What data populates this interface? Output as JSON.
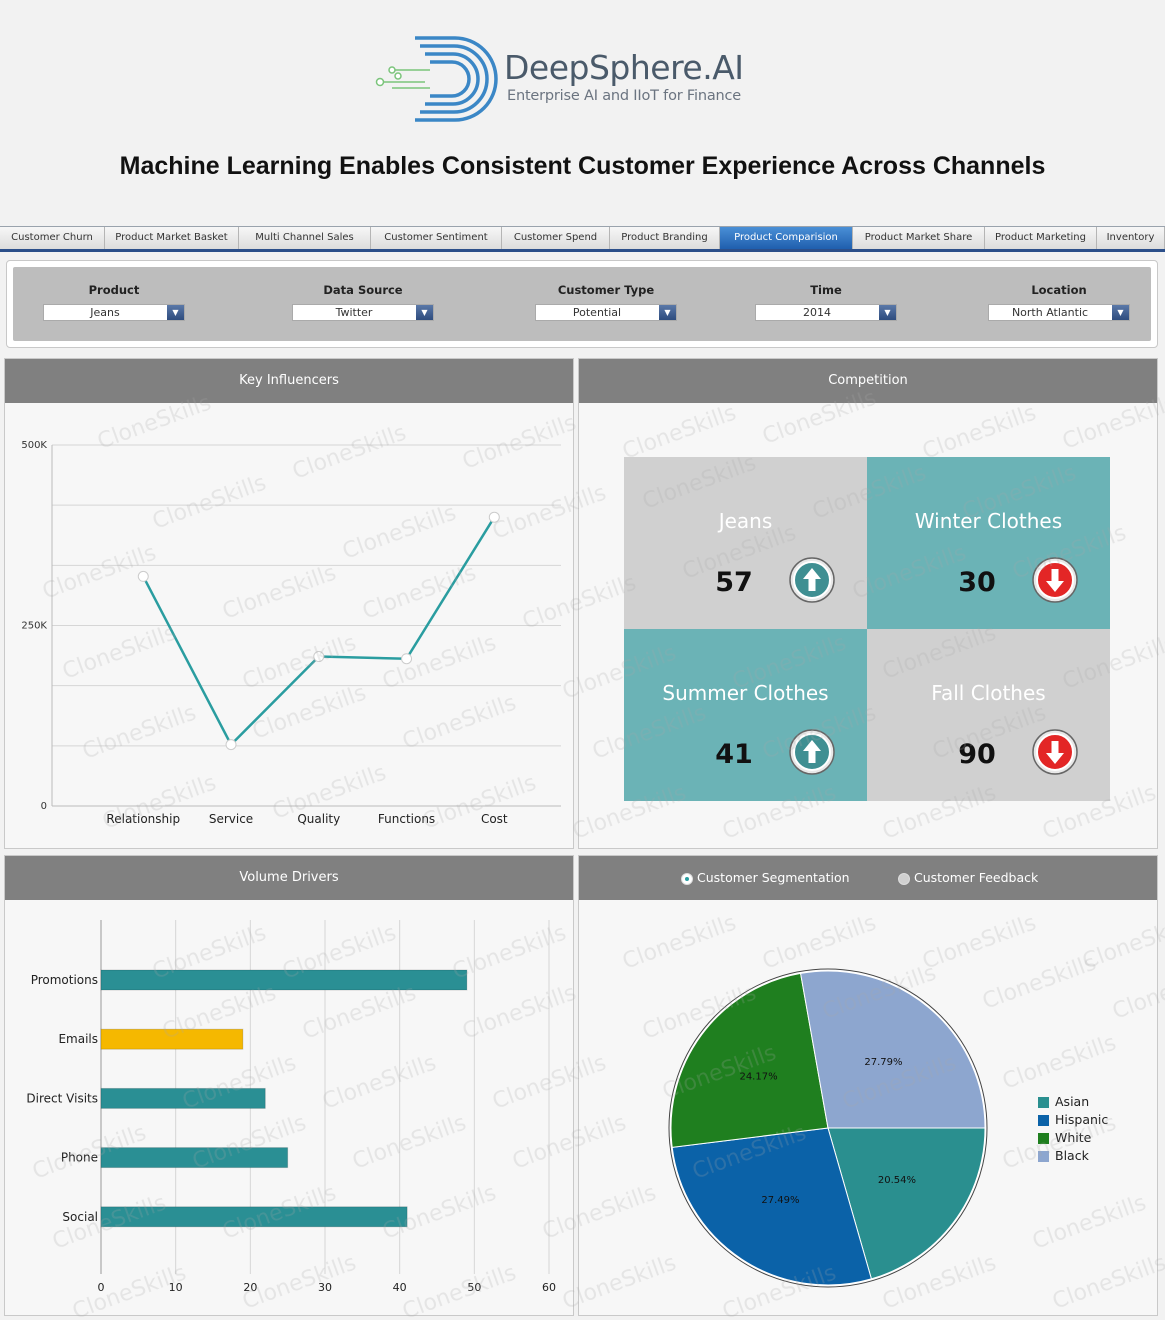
{
  "brand": {
    "name": "DeepSphere.AI",
    "tagline": "Enterprise AI and IIoT for Finance"
  },
  "page_title": "Machine Learning Enables Consistent Customer Experience Across Channels",
  "tabs": [
    {
      "label": "Customer Churn",
      "active": false
    },
    {
      "label": "Product Market Basket",
      "active": false
    },
    {
      "label": "Multi Channel Sales",
      "active": false
    },
    {
      "label": "Customer Sentiment",
      "active": false
    },
    {
      "label": "Customer Spend",
      "active": false
    },
    {
      "label": "Product Branding",
      "active": false
    },
    {
      "label": "Product Comparision",
      "active": true
    },
    {
      "label": "Product Market Share",
      "active": false
    },
    {
      "label": "Product Marketing",
      "active": false
    },
    {
      "label": "Inventory",
      "active": false
    }
  ],
  "filters": [
    {
      "label": "Product",
      "value": "Jeans"
    },
    {
      "label": "Data Source",
      "value": "Twitter"
    },
    {
      "label": "Customer Type",
      "value": "Potential"
    },
    {
      "label": "Time",
      "value": "2014"
    },
    {
      "label": "Location",
      "value": "North Atlantic"
    }
  ],
  "watermark_text": "CloneSkills",
  "key_influencers": {
    "title": "Key Influencers",
    "line_color": "#2a9da0"
  },
  "competition": {
    "title": "Competition",
    "tiles": [
      {
        "name": "Jeans",
        "value": "57",
        "trend": "up",
        "bg": "#d0d0d0"
      },
      {
        "name": "Winter Clothes",
        "value": "30",
        "trend": "down",
        "bg": "#6bb3b6"
      },
      {
        "name": "Summer Clothes",
        "value": "41",
        "trend": "up",
        "bg": "#6bb3b6"
      },
      {
        "name": "Fall Clothes",
        "value": "90",
        "trend": "down",
        "bg": "#d0d0d0"
      }
    ]
  },
  "volume_drivers": {
    "title": "Volume Drivers"
  },
  "segmentation": {
    "options": [
      {
        "label": "Customer Segmentation",
        "selected": true
      },
      {
        "label": "Customer Feedback",
        "selected": false
      }
    ]
  },
  "chart_data": [
    {
      "type": "line",
      "categories": [
        "Relationship",
        "Service",
        "Quality",
        "Functions",
        "Cost"
      ],
      "values": [
        318000,
        85000,
        207000,
        204000,
        400000
      ],
      "ylim": [
        0,
        500000
      ],
      "yticks": [
        "0",
        "250K",
        "500K"
      ],
      "grid": true
    },
    {
      "type": "bar",
      "orientation": "horizontal",
      "categories": [
        "Promotions",
        "Emails",
        "Direct Visits",
        "Phone",
        "Social"
      ],
      "values": [
        49,
        19,
        22,
        25,
        41
      ],
      "colors": [
        "#2a8f94",
        "#f5b800",
        "#2a8f94",
        "#2a8f94",
        "#2a8f94"
      ],
      "xlim": [
        0,
        60
      ],
      "xticks": [
        "0",
        "10",
        "20",
        "30",
        "40",
        "50",
        "60"
      ],
      "grid": true
    },
    {
      "type": "pie",
      "labels": [
        "Asian",
        "Hispanic",
        "White",
        "Black"
      ],
      "values": [
        20.54,
        27.49,
        24.17,
        27.79
      ],
      "data_labels": [
        "20.54%",
        "27.49%",
        "24.17%",
        "27.79%"
      ],
      "colors": [
        "#2a8f8f",
        "#0b62a8",
        "#1f7f1f",
        "#8da6cf"
      ],
      "legend": "right"
    }
  ]
}
